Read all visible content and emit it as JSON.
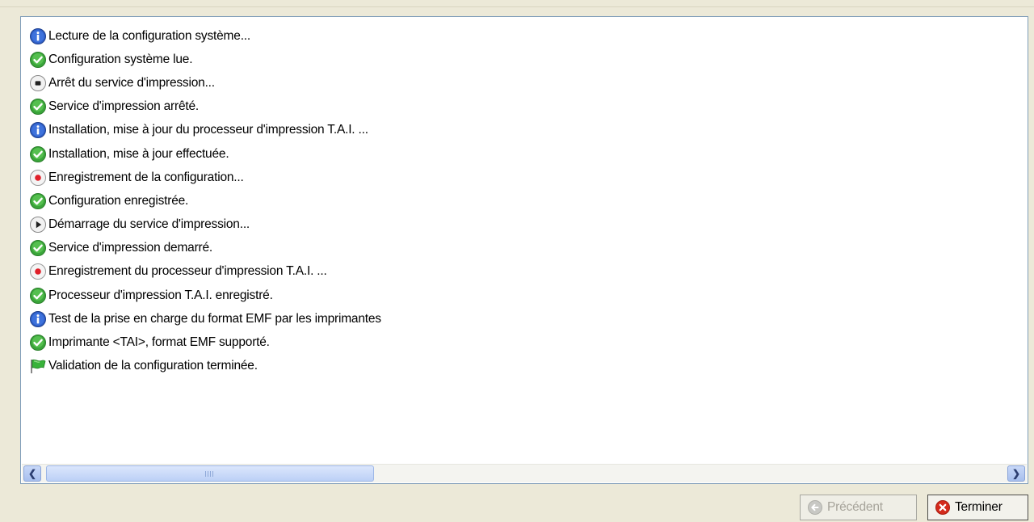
{
  "log": [
    {
      "icon": "info-icon",
      "text": "Lecture de la configuration système..."
    },
    {
      "icon": "check-icon",
      "text": "Configuration système lue."
    },
    {
      "icon": "stop-icon",
      "text": "Arrêt du service d'impression..."
    },
    {
      "icon": "check-icon",
      "text": "Service d'impression arrêté."
    },
    {
      "icon": "info-icon",
      "text": "Installation, mise à jour du processeur d'impression T.A.I. ..."
    },
    {
      "icon": "check-icon",
      "text": "Installation, mise à jour effectuée."
    },
    {
      "icon": "record-icon",
      "text": "Enregistrement de la configuration..."
    },
    {
      "icon": "check-icon",
      "text": "Configuration enregistrée."
    },
    {
      "icon": "play-icon",
      "text": "Démarrage du service d'impression..."
    },
    {
      "icon": "check-icon",
      "text": "Service d'impression demarré."
    },
    {
      "icon": "record-icon",
      "text": "Enregistrement du processeur d'impression T.A.I. ..."
    },
    {
      "icon": "check-icon",
      "text": "Processeur d'impression T.A.I. enregistré."
    },
    {
      "icon": "info-icon",
      "text": "Test de la prise en charge du format EMF par les imprimantes"
    },
    {
      "icon": "check-icon",
      "text": "Imprimante <TAI>, format EMF supporté."
    },
    {
      "icon": "flag-icon",
      "text": "Validation de la configuration terminée."
    }
  ],
  "buttons": {
    "previous": {
      "label": "Précédent",
      "icon": "back-arrow-icon",
      "enabled": false
    },
    "finish": {
      "label": "Terminer",
      "icon": "close-circle-icon",
      "enabled": true
    }
  },
  "colors": {
    "info": "#2f5fc8",
    "success": "#3aa53a",
    "record": "#e0202a",
    "finish_icon": "#d42a1c",
    "accent_scroll": "#bcd0f6"
  }
}
